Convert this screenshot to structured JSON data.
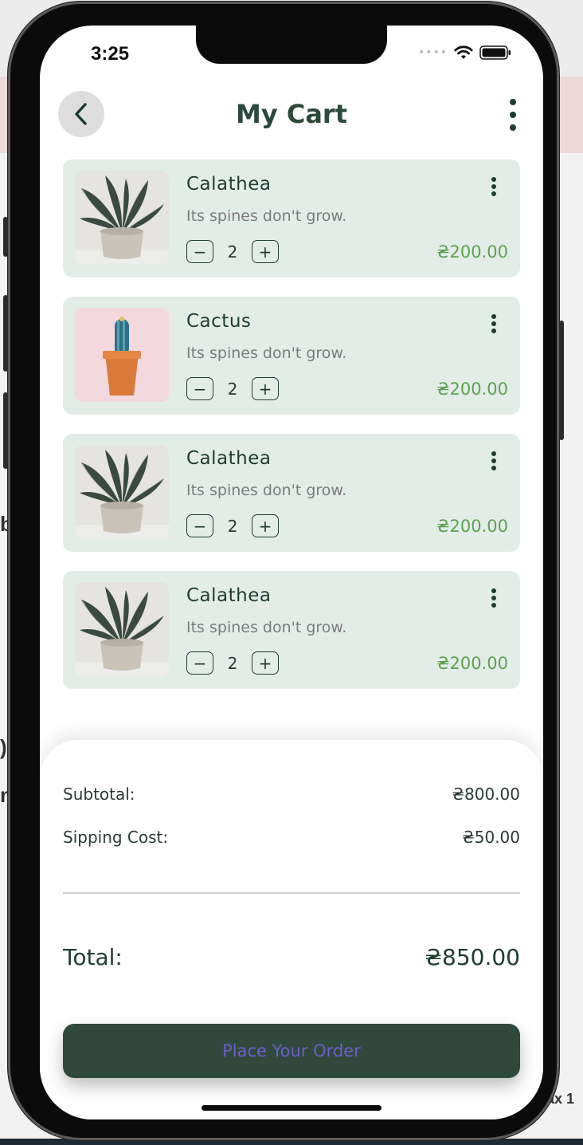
{
  "status": {
    "time": "3:25"
  },
  "header": {
    "title": "My Cart"
  },
  "cart": {
    "items": [
      {
        "name": "Calathea",
        "description": "Its spines don't grow.",
        "quantity": "2",
        "price": "₴200.00",
        "image": "calathea"
      },
      {
        "name": "Cactus",
        "description": "Its spines don't grow.",
        "quantity": "2",
        "price": "₴200.00",
        "image": "cactus"
      },
      {
        "name": "Calathea",
        "description": "Its spines don't grow.",
        "quantity": "2",
        "price": "₴200.00",
        "image": "calathea"
      },
      {
        "name": "Calathea",
        "description": "Its spines don't grow.",
        "quantity": "2",
        "price": "₴200.00",
        "image": "calathea"
      }
    ]
  },
  "summary": {
    "subtotal_label": "Subtotal:",
    "subtotal_value": "₴800.00",
    "shipping_label": "Sipping Cost:",
    "shipping_value": "₴50.00",
    "total_label": "Total:",
    "total_value": "₴850.00",
    "order_button": "Place Your Order"
  },
  "background_fragments": {
    "left_1": "b",
    "left_2": ")",
    "left_3": "n",
    "bottom_right": "ax 1"
  },
  "colors": {
    "primary_dark": "#2f4a3d",
    "card_bg": "#e3ede8",
    "price_green": "#5da24f",
    "button_text": "#6e5ec7"
  }
}
